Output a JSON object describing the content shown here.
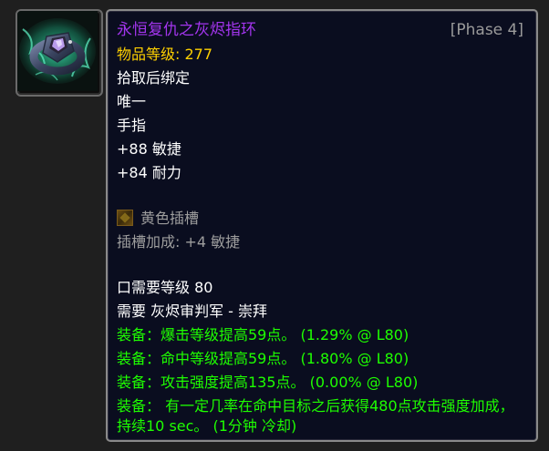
{
  "item": {
    "name": "永恒复仇之灰烬指环",
    "phase": "[Phase 4]",
    "item_level_label": "物品等级: ",
    "item_level_value": "277",
    "bind": "拾取后绑定",
    "unique": "唯一",
    "slot": "手指",
    "stat_agility": "+88 敏捷",
    "stat_stamina": "+84 耐力",
    "socket_label": "黄色插槽",
    "socket_bonus": "插槽加成: +4 敏捷",
    "req_level": "口需要等级 80",
    "req_rep": "需要 灰烬审判军 - 崇拜",
    "equip_1": "装备：爆击等级提高59点。 (1.29% @ L80)",
    "equip_2": "装备：命中等级提高59点。 (1.80% @ L80)",
    "equip_3": "装备：攻击强度提高135点。 (0.00% @ L80)",
    "equip_4": "装备：  有一定几率在命中目标之后获得480点攻击强度加成，持续10 sec。 (1分钟 冷却)"
  },
  "icon": {
    "name": "ring-item-icon",
    "colors": {
      "glow": "#3fe6b0",
      "metal": "#4a5570",
      "gem": "#c9a8ff"
    }
  },
  "colors": {
    "epic": "#a335ee",
    "item_level": "#ffd100",
    "uncommon_green": "#1eff00",
    "grey": "#9d9d9d",
    "white": "#ffffff",
    "tooltip_bg": "#0a0d1f"
  }
}
